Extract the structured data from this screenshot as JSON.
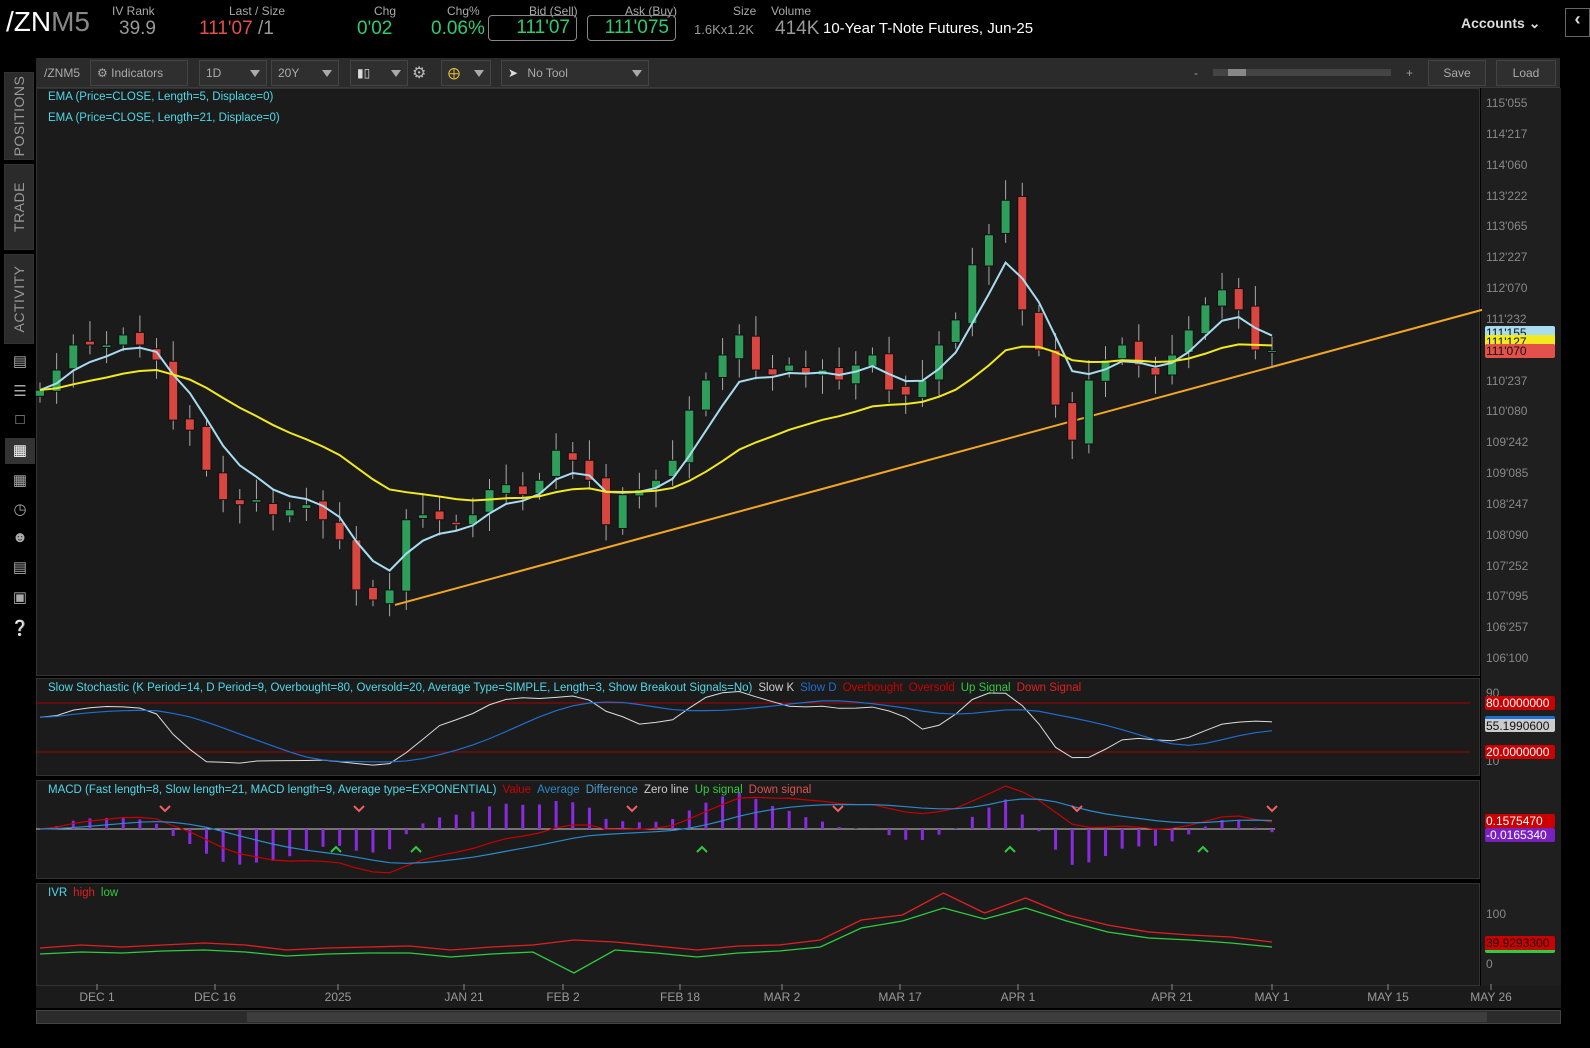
{
  "header": {
    "symbol_main": "/ZN",
    "symbol_suffix": "M5",
    "iv_rank_label": "IV Rank",
    "iv_rank": "39.9",
    "last_label": "Last / Size",
    "last": "111'07",
    "last_size": "/1",
    "chg_label": "Chg",
    "chg": "0'02",
    "chgpct_label": "Chg%",
    "chgpct": "0.06%",
    "bid_label": "Bid (Sell)",
    "bid": "111'07",
    "ask_label": "Ask (Buy)",
    "ask": "111'075",
    "size_label": "Size",
    "size": "1.6Kx1.2K",
    "volume_label": "Volume",
    "volume": "414K",
    "description": "10-Year T-Note Futures, Jun-25",
    "accounts": "Accounts"
  },
  "toolbar": {
    "symbol": "/ZNM5",
    "indicators": "Indicators",
    "aggregation": "1D",
    "range": "20Y",
    "tool": "No Tool",
    "zoom_minus": "-",
    "zoom_plus": "+",
    "save": "Save",
    "load": "Load"
  },
  "sidebar": {
    "tabs": [
      "POSITIONS",
      "TRADE",
      "ACTIVITY"
    ]
  },
  "main": {
    "ema1_label": "EMA (Price=CLOSE, Length=5, Displace=0)",
    "ema2_label": "EMA (Price=CLOSE, Length=21, Displace=0)",
    "price_ticks": [
      "115'055",
      "114'217",
      "114'060",
      "113'222",
      "113'065",
      "112'227",
      "112'070",
      "111'232",
      "110'237",
      "110'080",
      "109'242",
      "109'085",
      "108'247",
      "108'090",
      "107'252",
      "107'095",
      "106'257",
      "106'100"
    ],
    "badges": [
      {
        "value": "111'155",
        "color": "#a8dcf0"
      },
      {
        "value": "111'127",
        "color": "#f2ea1c"
      },
      {
        "value": "111'070",
        "color": "#e4504a"
      }
    ]
  },
  "stochastic": {
    "title": "Slow Stochastic (K Period=14, D Period=9, Overbought=80, Oversold=20, Average Type=SIMPLE, Length=3, Show Breakout Signals=No)",
    "legend": [
      {
        "t": "Slow K",
        "c": "#ccc"
      },
      {
        "t": "Slow D",
        "c": "#1e6fd0"
      },
      {
        "t": "Overbought",
        "c": "#c00"
      },
      {
        "t": "Oversold",
        "c": "#c00"
      },
      {
        "t": "Up Signal",
        "c": "#2ecc40"
      },
      {
        "t": "Down Signal",
        "c": "#e02020"
      }
    ],
    "overbought": "80.0000000",
    "oversold": "20.0000000",
    "current": "55.1990600",
    "ticks": [
      "90",
      "10"
    ]
  },
  "macd": {
    "title": "MACD (Fast length=8, Slow length=21, MACD length=9, Average type=EXPONENTIAL)",
    "legend": [
      {
        "t": "Value",
        "c": "#c00"
      },
      {
        "t": "Average",
        "c": "#2a8acb"
      },
      {
        "t": "Difference",
        "c": "#4aa0d0"
      },
      {
        "t": "Zero line",
        "c": "#ccc"
      },
      {
        "t": "Up signal",
        "c": "#2ecc40"
      },
      {
        "t": "Down signal",
        "c": "#e05050"
      }
    ],
    "value": "0.1575470",
    "diff": "-0.0165340"
  },
  "ivr": {
    "title": "IVR",
    "high_label": "high",
    "low_label": "low",
    "current": "39.9293300",
    "ticks": [
      "100",
      "0"
    ]
  },
  "chart_data": {
    "type": "candlestick",
    "symbol": "/ZNM5",
    "x_ticks": [
      "DEC 1",
      "DEC 16",
      "2025",
      "JAN 21",
      "FEB 2",
      "FEB 18",
      "MAR 2",
      "MAR 17",
      "APR 1",
      "APR 21",
      "MAY 1",
      "MAY 15",
      "MAY 26"
    ],
    "closes": [
      110.59,
      110.91,
      111.31,
      111.31,
      111.31,
      111.47,
      111.31,
      111.07,
      110.11,
      109.95,
      109.31,
      108.84,
      108.76,
      108.84,
      108.6,
      108.68,
      108.76,
      108.52,
      108.2,
      107.4,
      107.24,
      107.4,
      108.52,
      108.6,
      108.52,
      108.44,
      108.6,
      109.0,
      109.08,
      108.92,
      109.15,
      109.63,
      109.47,
      109.15,
      108.44,
      108.92,
      109.0,
      109.15,
      109.47,
      110.27,
      110.75,
      111.15,
      111.47,
      110.91,
      110.83,
      110.99,
      110.83,
      110.91,
      110.75,
      110.99,
      111.15,
      110.59,
      110.51,
      110.75,
      111.31,
      111.71,
      112.59,
      113.07,
      113.62,
      111.87,
      111.23,
      110.35,
      109.79,
      110.75,
      111.07,
      111.31,
      110.99,
      110.83,
      111.15,
      111.55,
      111.95,
      112.19,
      111.87,
      111.23,
      111.22
    ],
    "trendline": {
      "start_price": 107.16,
      "start_label": "JAN 10",
      "end_price": 111.87
    },
    "ivr_high": [
      30,
      36,
      32,
      36,
      40,
      36,
      26,
      30,
      32,
      34,
      26,
      32,
      36,
      46,
      42,
      34,
      26,
      34,
      36,
      46,
      86,
      96,
      140,
      100,
      130,
      96,
      76,
      62,
      56,
      52,
      42
    ],
    "ivr_low": [
      18,
      22,
      20,
      24,
      26,
      22,
      14,
      18,
      20,
      20,
      12,
      18,
      22,
      -20,
      26,
      20,
      12,
      20,
      24,
      32,
      70,
      84,
      110,
      88,
      110,
      84,
      62,
      50,
      46,
      40,
      32
    ],
    "price_axis_range": [
      105.9,
      115.3
    ]
  },
  "colors": {
    "up": "#2e9e5a",
    "down": "#d9453f",
    "ema5": "#a8dcf0",
    "ema21": "#f2ea1c",
    "trend": "#f5a623"
  }
}
